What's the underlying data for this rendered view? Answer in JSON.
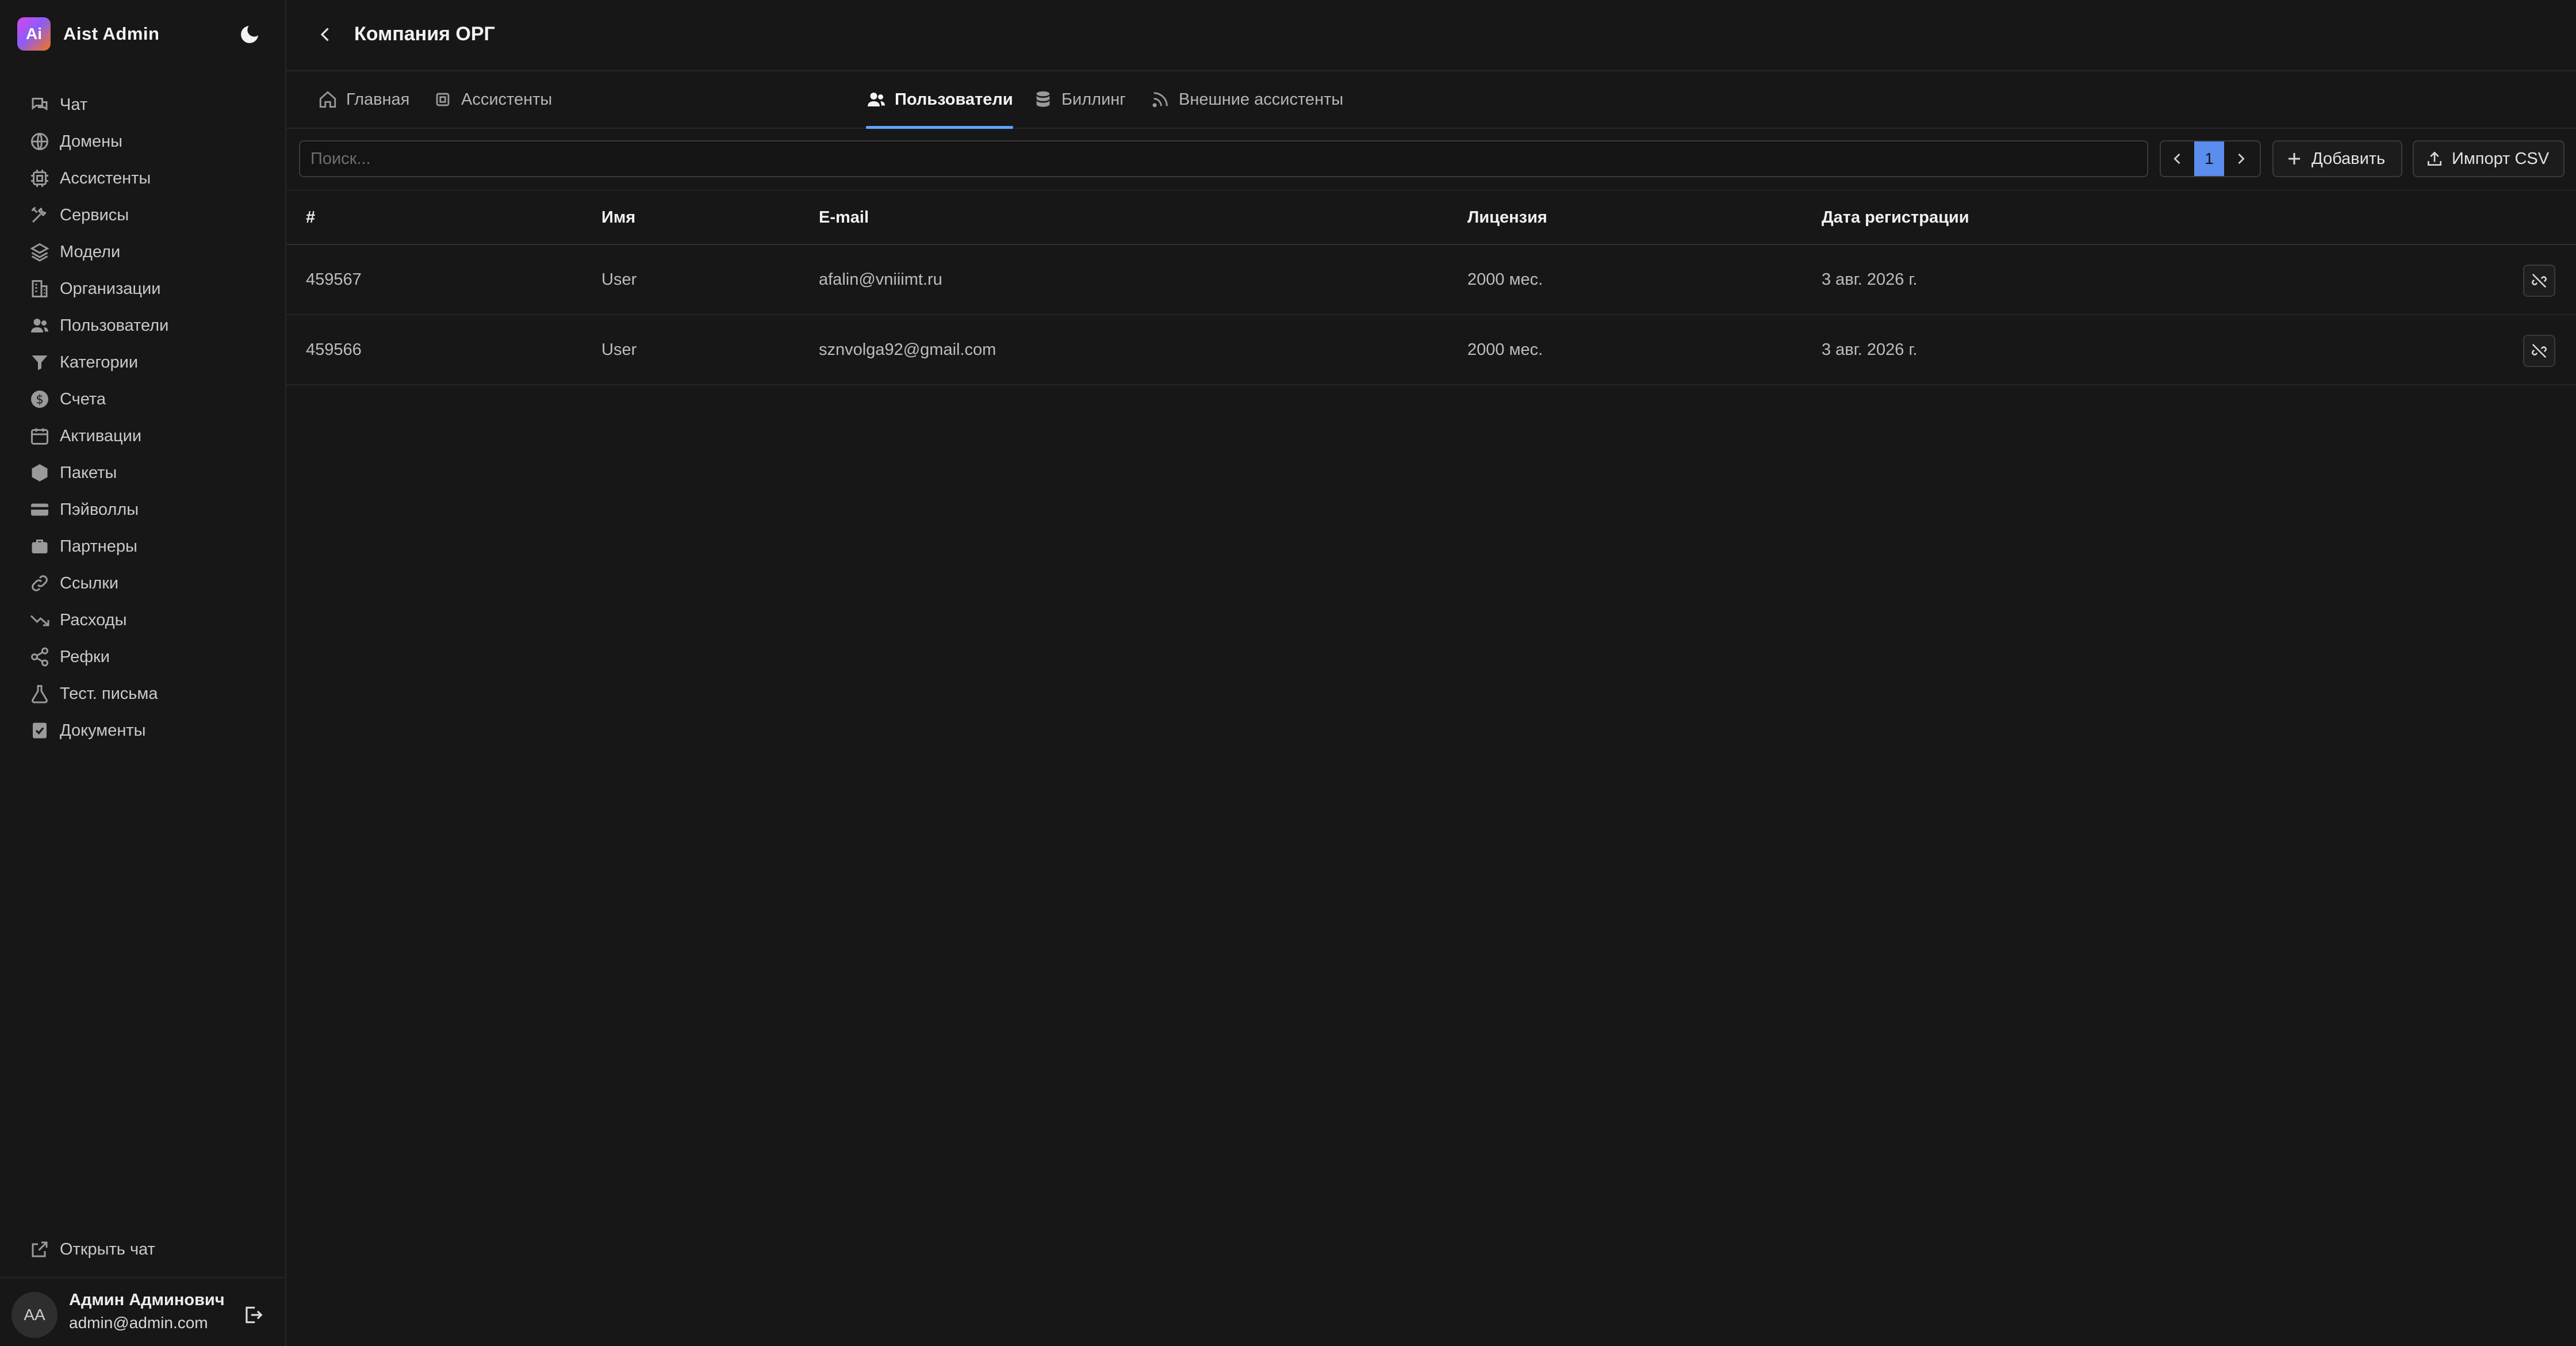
{
  "brand": {
    "logo_text": "Ai",
    "name": "Aist Admin"
  },
  "sidebar": {
    "items": [
      {
        "label": "Чат",
        "icon": "chat-icon"
      },
      {
        "label": "Домены",
        "icon": "globe-icon"
      },
      {
        "label": "Ассистенты",
        "icon": "cpu-icon"
      },
      {
        "label": "Сервисы",
        "icon": "tools-icon"
      },
      {
        "label": "Модели",
        "icon": "layers-icon"
      },
      {
        "label": "Организации",
        "icon": "building-icon"
      },
      {
        "label": "Пользователи",
        "icon": "users-icon"
      },
      {
        "label": "Категории",
        "icon": "filter-icon"
      },
      {
        "label": "Счета",
        "icon": "dollar-icon"
      },
      {
        "label": "Активации",
        "icon": "calendar-icon"
      },
      {
        "label": "Пакеты",
        "icon": "package-icon"
      },
      {
        "label": "Пэйволлы",
        "icon": "credit-card-icon"
      },
      {
        "label": "Партнеры",
        "icon": "briefcase-icon"
      },
      {
        "label": "Ссылки",
        "icon": "link-icon"
      },
      {
        "label": "Расходы",
        "icon": "trend-down-icon"
      },
      {
        "label": "Рефки",
        "icon": "share-icon"
      },
      {
        "label": "Тест. письма",
        "icon": "flask-icon"
      },
      {
        "label": "Документы",
        "icon": "document-check-icon"
      }
    ],
    "open_chat_label": "Открыть чат",
    "user": {
      "initials": "AA",
      "name": "Админ Админович",
      "email": "admin@admin.com"
    }
  },
  "header": {
    "title": "Компания ОРГ"
  },
  "tabs": [
    {
      "label": "Главная",
      "icon": "home-icon",
      "active": false
    },
    {
      "label": "Ассистенты",
      "icon": "cpu-icon",
      "active": false
    },
    {
      "label": "Пользователи",
      "icon": "users-icon",
      "active": true
    },
    {
      "label": "Биллинг",
      "icon": "database-icon",
      "active": false
    },
    {
      "label": "Внешние ассистенты",
      "icon": "rss-icon",
      "active": false
    }
  ],
  "toolbar": {
    "search_placeholder": "Поиск...",
    "search_value": "",
    "page": "1",
    "add_label": "Добавить",
    "import_label": "Импорт CSV"
  },
  "table": {
    "columns": [
      "#",
      "Имя",
      "E-mail",
      "Лицензия",
      "Дата регистрации"
    ],
    "rows": [
      {
        "id": "459567",
        "name": "User",
        "email": "afalin@vniiimt.ru",
        "license": "2000 мес.",
        "registered": "3 авг. 2026 г."
      },
      {
        "id": "459566",
        "name": "User",
        "email": "sznvolga92@gmail.com",
        "license": "2000 мес.",
        "registered": "3 авг. 2026 г."
      }
    ]
  },
  "colors": {
    "accent": "#60a5fa",
    "page_active_bg": "#5b8def",
    "background": "#171717"
  }
}
